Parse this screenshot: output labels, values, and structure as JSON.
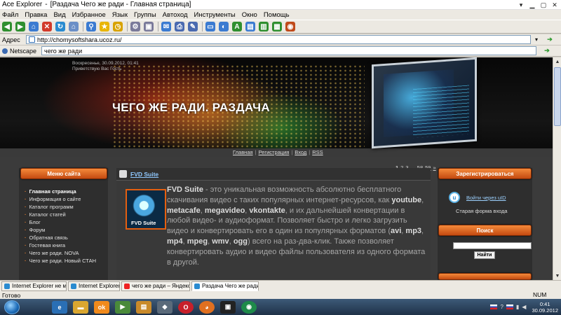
{
  "window": {
    "app": "Ace Explorer",
    "title": "[Раздача Чего же ради - Главная страница]",
    "controls": {
      "menu": "▾",
      "min": "▁",
      "max": "▢",
      "close": "✕"
    }
  },
  "menu": [
    "Файл",
    "Правка",
    "Вид",
    "Избранное",
    "Язык",
    "Группы",
    "Автоход",
    "Инструменты",
    "Окно",
    "Помощь"
  ],
  "address": {
    "label": "Адрес",
    "url": "http://chomysoftshara.ucoz.ru/",
    "dropdown": "▾",
    "go": "➔"
  },
  "searchbar": {
    "engine": "Netscape",
    "query": "чего же ради",
    "go": "➔"
  },
  "banner": {
    "date": "Воскресенье, 30.09.2012, 01:41",
    "greeting": "Приветствую Вас Гость",
    "title": "ЧЕГО ЖЕ РАДИ. РАЗДАЧА"
  },
  "nav": {
    "home": "Главная",
    "register": "Регистрация",
    "login": "Вход",
    "rss": "RSS",
    "sep": "|"
  },
  "pager": {
    "p1": "1",
    "p2": "2",
    "p3": "3",
    "dots": "...",
    "p58": "58",
    "p59": "59",
    "next": "»"
  },
  "sidebar": {
    "button": "Меню сайта",
    "items": [
      "Главная страница",
      "Информация о сайте",
      "Каталог программ",
      "Каталог статей",
      "Блог",
      "Форум",
      "Обратная связь",
      "Гостевая книга",
      "Чего же ради. NOVA",
      "Чего же ради. Новый СТАН"
    ]
  },
  "post": {
    "title": "FVD Suite",
    "thumb_label": "FVD Suite",
    "text": {
      "s1": "FVD Suite",
      "s2": " - это уникальная возможность абсолютно бесплатного скачивания видео с таких популярных интернет-ресурсов, как ",
      "youtube": "youtube",
      "c1": ", ",
      "metacafe": "metacafe",
      "c2": ", ",
      "megavideo": "megavideo",
      "c3": ", ",
      "vkontakte": "vkontakte",
      "s3": ", и их дальнейшей конвертации в любой видео- и аудиоформат. Позволяет быстро и легко загрузить видео и конвертировать его в один из популярных форматов (",
      "avi": "avi",
      "c4": ", ",
      "mp3": "mp3",
      "c5": ", ",
      "mp4": "mp4",
      "c6": ", ",
      "mpeg": "mpeg",
      "c7": ", ",
      "wmv": "wmv",
      "c8": ", ",
      "ogg": "ogg",
      "s4": ") всего на раз-два-клик. Также позволяет конвертировать аудио и видео файлы пользователя из одного формата в другой."
    }
  },
  "rightbar": {
    "register_button": "Зарегистрироваться",
    "uid_link": "Войти через uID",
    "old_form": "Старая форма входа",
    "search_button": "Поиск",
    "search_submit": "Найти"
  },
  "tabs": [
    "Internet Explorer не м...",
    "Internet Explorer не м...",
    "чего же ради – Яндекс:...",
    "Раздача Чего же ради -..."
  ],
  "status": {
    "text": "Готово",
    "num": "NUM"
  },
  "taskbar": {
    "time": "0:41",
    "date": "30.09.2012"
  },
  "colors": {
    "accent_orange": "#e25a14",
    "page_bg": "#3a3a3a",
    "link_blue": "#8fc8ff"
  }
}
